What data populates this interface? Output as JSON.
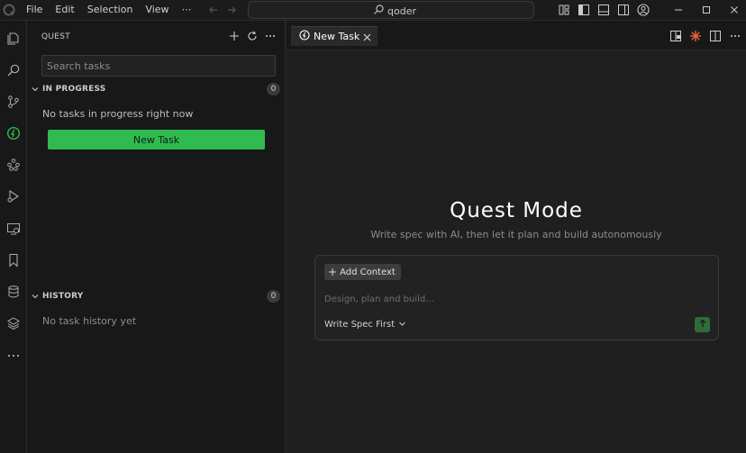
{
  "app": {
    "logo_icon": "qoder-logo-icon"
  },
  "menu": [
    "File",
    "Edit",
    "Selection",
    "View",
    "⋯"
  ],
  "command_center": {
    "text": "qoder",
    "icon": "search-icon"
  },
  "sidebar": {
    "title": "QUEST",
    "search_placeholder": "Search tasks",
    "in_progress": {
      "label": "IN PROGRESS",
      "count": "0",
      "empty_text": "No tasks in progress right now",
      "new_task_button": "New Task"
    },
    "history": {
      "label": "HISTORY",
      "count": "0",
      "empty_text": "No task history yet"
    }
  },
  "editor": {
    "tab_label": "New Task",
    "title": "Quest Mode",
    "subtitle": "Write spec with AI, then let it plan and build autonomously",
    "composer": {
      "add_context_label": "Add Context",
      "input_placeholder": "Design, plan and build...",
      "mode_label": "Write Spec First"
    }
  },
  "colors": {
    "accent": "#2fbb4f",
    "background": "#1f1f1f",
    "sidebar_bg": "#181818"
  }
}
